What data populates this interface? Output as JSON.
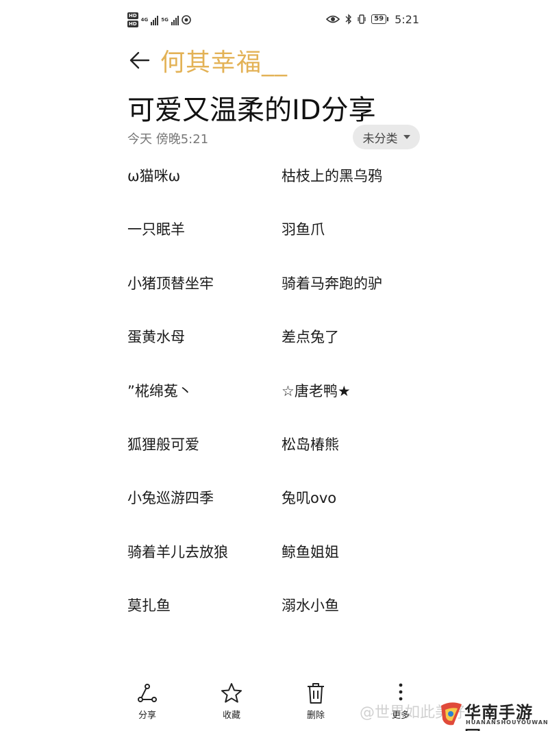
{
  "status": {
    "left_badges": [
      "HD",
      "HD"
    ],
    "net_1": "4G",
    "net_2": "5G",
    "battery": "59",
    "time": "5:21"
  },
  "note": {
    "author": "何其幸福__",
    "title": "可爱又温柔的ID分享",
    "time": "今天 傍晚5:21",
    "category": "未分类"
  },
  "ids": [
    {
      "left": "ω猫咪ω",
      "right": "枯枝上的黑乌鸦"
    },
    {
      "left": "一只眠羊",
      "right": "羽鱼爪"
    },
    {
      "left": "小猪顶替坐牢",
      "right": "骑着马奔跑的驴"
    },
    {
      "left": "蛋黄水母",
      "right": "差点兔了"
    },
    {
      "left": "”椛绵菟丶",
      "right": "☆唐老鸭★"
    },
    {
      "left": "狐狸般可爱",
      "right": "松岛椿熊"
    },
    {
      "left": "小兔巡游四季",
      "right": " 兔叽ovo"
    },
    {
      "left": "骑着羊儿去放狼",
      "right": " 鲸鱼姐姐"
    },
    {
      "left": "莫扎鱼",
      "right": "溺水小鱼"
    }
  ],
  "toolbar": {
    "share": "分享",
    "favorite": "收藏",
    "delete": "删除",
    "more": "更多"
  },
  "watermark": {
    "text": "@世界如此美好",
    "brand_name": "华南手游网",
    "brand_sub": "HUANANSHOUYOUWANG"
  },
  "colors": {
    "author": "#e3b256",
    "chip_bg": "#e9e9e9"
  }
}
